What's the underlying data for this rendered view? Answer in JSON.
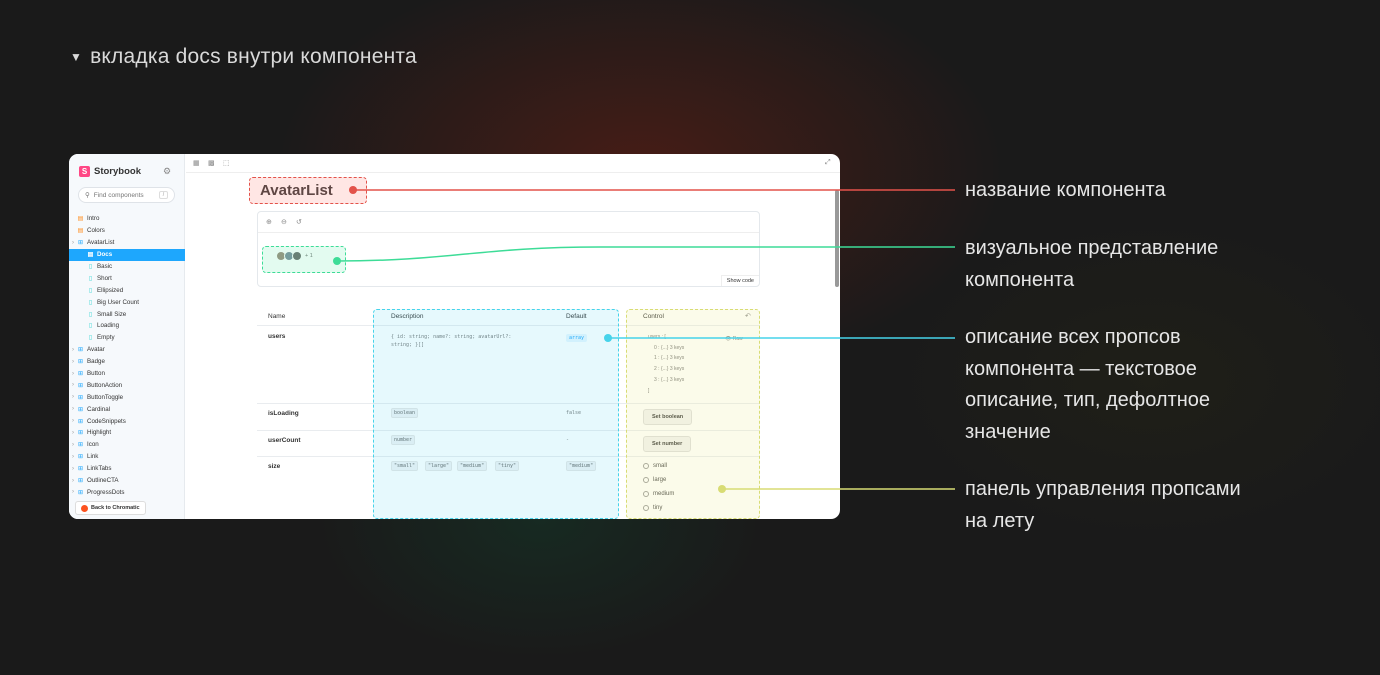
{
  "heading": "вкладка docs внутри компонента",
  "storybook": {
    "brand": "Storybook",
    "search_placeholder": "Find components",
    "search_shortcut": "/",
    "nav": [
      {
        "label": "Intro",
        "kind": "doc",
        "level": 0
      },
      {
        "label": "Colors",
        "kind": "doc",
        "level": 0
      },
      {
        "label": "AvatarList",
        "kind": "group",
        "level": 0
      },
      {
        "label": "Docs",
        "kind": "doc",
        "level": 1,
        "active": true
      },
      {
        "label": "Basic",
        "kind": "story",
        "level": 1
      },
      {
        "label": "Short",
        "kind": "story",
        "level": 1
      },
      {
        "label": "Ellipsized",
        "kind": "story",
        "level": 1
      },
      {
        "label": "Big User Count",
        "kind": "story",
        "level": 1
      },
      {
        "label": "Small Size",
        "kind": "story",
        "level": 1
      },
      {
        "label": "Loading",
        "kind": "story",
        "level": 1
      },
      {
        "label": "Empty",
        "kind": "story",
        "level": 1
      },
      {
        "label": "Avatar",
        "kind": "group",
        "level": 0
      },
      {
        "label": "Badge",
        "kind": "group",
        "level": 0
      },
      {
        "label": "Button",
        "kind": "group",
        "level": 0
      },
      {
        "label": "ButtonAction",
        "kind": "group",
        "level": 0
      },
      {
        "label": "ButtonToggle",
        "kind": "group",
        "level": 0
      },
      {
        "label": "Cardinal",
        "kind": "group",
        "level": 0
      },
      {
        "label": "CodeSnippets",
        "kind": "group",
        "level": 0
      },
      {
        "label": "Highlight",
        "kind": "group",
        "level": 0
      },
      {
        "label": "Icon",
        "kind": "group",
        "level": 0
      },
      {
        "label": "Link",
        "kind": "group",
        "level": 0
      },
      {
        "label": "LinkTabs",
        "kind": "group",
        "level": 0
      },
      {
        "label": "OutlineCTA",
        "kind": "group",
        "level": 0
      },
      {
        "label": "ProgressDots",
        "kind": "group",
        "level": 0
      }
    ],
    "chromatic_button": "Back to Chromatic",
    "component_title": "AvatarList",
    "plus_count": "+ 1",
    "show_code": "Show code",
    "table": {
      "headers": {
        "name": "Name",
        "description": "Description",
        "default": "Default",
        "control": "Control"
      },
      "rows": {
        "users": {
          "name": "users",
          "type_line1": "{ id: string; name?: string; avatarUrl?:",
          "type_line2": "string; }[]",
          "default": "array",
          "raw_label": "Raw",
          "tree_root": "users : [",
          "tree_items": [
            "0 : {...} 3 keys",
            "1 : {...} 3 keys",
            "2 : {...} 3 keys",
            "3 : {...} 3 keys"
          ],
          "tree_close": "]"
        },
        "isLoading": {
          "name": "isLoading",
          "type": "boolean",
          "default": "false",
          "control": "Set boolean"
        },
        "userCount": {
          "name": "userCount",
          "type": "number",
          "default": "-",
          "control": "Set number"
        },
        "size": {
          "name": "size",
          "types": [
            "\"small\"",
            "\"large\"",
            "\"medium\"",
            "\"tiny\""
          ],
          "default": "\"medium\"",
          "options": [
            "small",
            "large",
            "medium",
            "tiny"
          ]
        }
      }
    }
  },
  "annotations": {
    "name": [
      "название компонента"
    ],
    "visual": [
      "визуальное представление",
      "компонента"
    ],
    "props": [
      "описание всех пропсов",
      "компонента — текстовое",
      "описание, тип, дефолтное",
      "значение"
    ],
    "controls": [
      "панель управления пропсами",
      "на лету"
    ]
  },
  "colors": {
    "red": "#e3524a",
    "green": "#3ddc97",
    "cyan": "#46d3ea",
    "yellow": "#d8dc74",
    "storybook_accent": "#1ea7fd",
    "storybook_brand": "#ff4785"
  }
}
